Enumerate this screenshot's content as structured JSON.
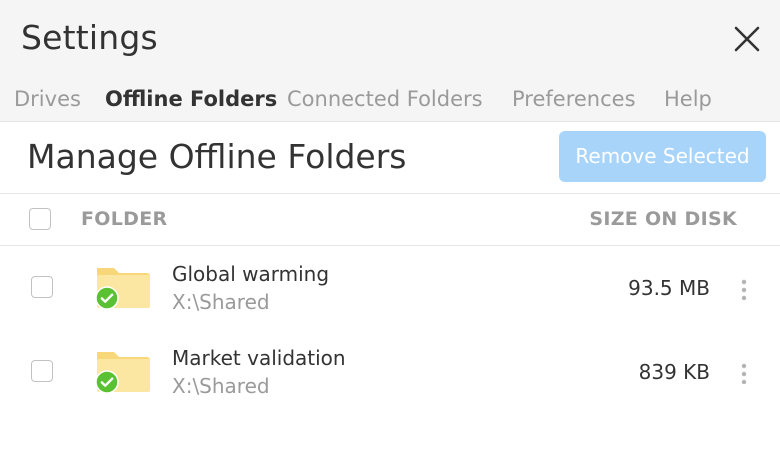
{
  "window": {
    "title": "Settings"
  },
  "tabs": [
    {
      "label": "Drives",
      "active": false
    },
    {
      "label": "Offline Folders",
      "active": true
    },
    {
      "label": "Connected Folders",
      "active": false
    },
    {
      "label": "Preferences",
      "active": false
    },
    {
      "label": "Help",
      "active": false
    }
  ],
  "main": {
    "heading": "Manage Offline Folders",
    "remove_button_label": "Remove Selected",
    "remove_button_enabled": false
  },
  "table": {
    "columns": {
      "folder": "FOLDER",
      "size": "SIZE ON DISK"
    },
    "rows": [
      {
        "name": "Global warming",
        "path": "X:\\Shared",
        "size": "93.5 MB",
        "checked": false,
        "status": "synced"
      },
      {
        "name": "Market validation",
        "path": "X:\\Shared",
        "size": "839 KB",
        "checked": false,
        "status": "synced"
      }
    ]
  },
  "colors": {
    "accent_disabled": "#a8d4fa",
    "folder_yellow": "#fbe7a1",
    "synced_green": "#5ac132",
    "muted_text": "#9a9a9a",
    "primary_text": "#333333"
  },
  "icons": {
    "close": "close-icon",
    "folder": "folder-icon",
    "synced": "check-circle-icon",
    "menu": "more-vertical-icon"
  }
}
